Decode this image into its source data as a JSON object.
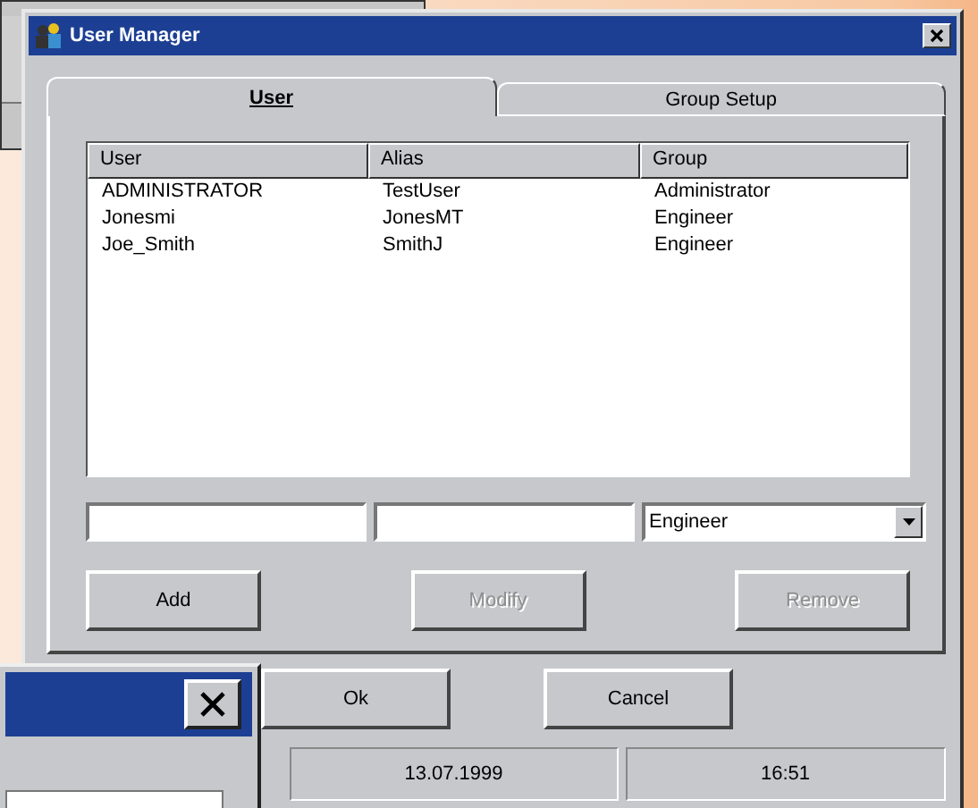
{
  "window": {
    "title": "User Manager"
  },
  "tabs": [
    {
      "label": "User",
      "selected": true
    },
    {
      "label": "Group Setup",
      "selected": false
    }
  ],
  "table": {
    "columns": [
      "User",
      "Alias",
      "Group"
    ],
    "rows": [
      [
        "ADMINISTRATOR",
        "TestUser",
        "Administrator"
      ],
      [
        "Jonesmi",
        "JonesMT",
        "Engineer"
      ],
      [
        "Joe_Smith",
        "SmithJ",
        "Engineer"
      ]
    ]
  },
  "entry": {
    "group_value": "Engineer"
  },
  "buttons": [
    {
      "label": "Add",
      "disabled": false
    },
    {
      "label": "Modify",
      "disabled": true
    },
    {
      "label": "Remove",
      "disabled": true
    }
  ],
  "dialog_buttons": [
    {
      "label": "Ok"
    },
    {
      "label": "Cancel"
    }
  ],
  "status_bar": [
    "13.07.1999",
    "16:51"
  ]
}
